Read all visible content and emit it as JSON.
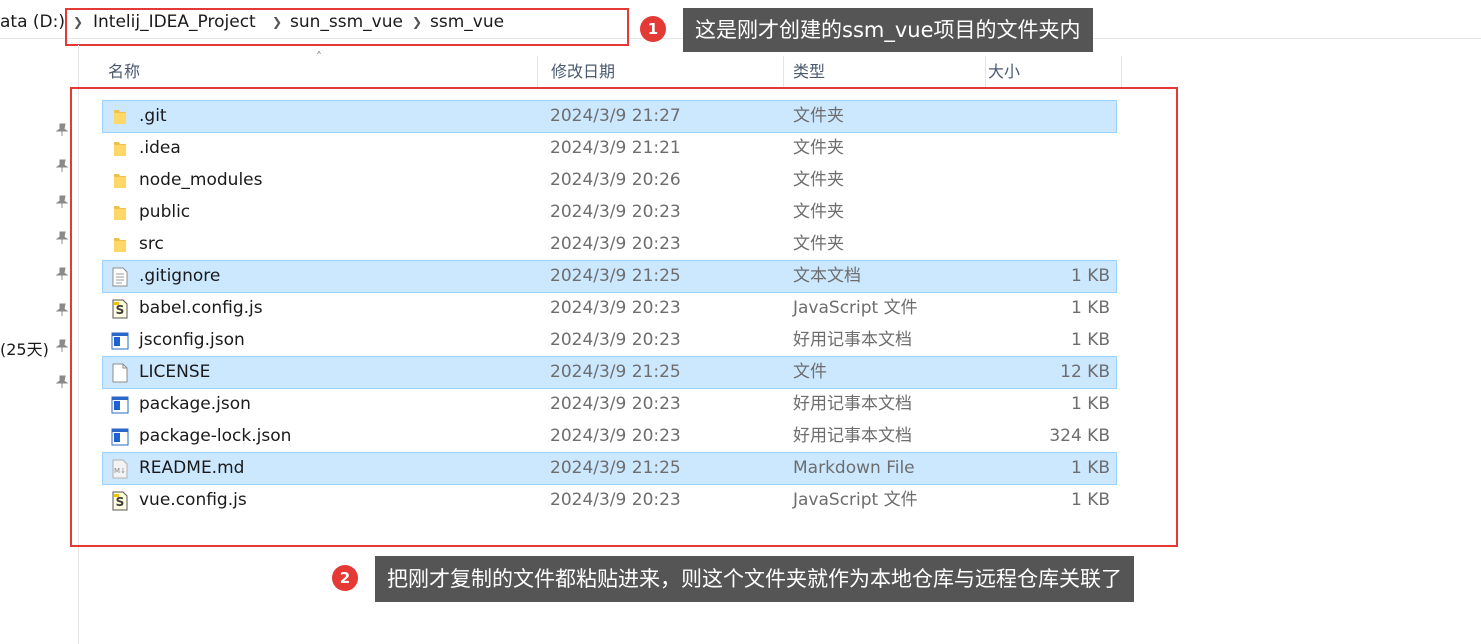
{
  "address": {
    "drive": "ata (D:)",
    "crumbs": [
      "Intelij_IDEA_Project",
      "sun_ssm_vue",
      "ssm_vue"
    ]
  },
  "annotations": {
    "one": {
      "num": "1",
      "text": "这是刚才创建的ssm_vue项目的文件夹内"
    },
    "two": {
      "num": "2",
      "text": "把刚才复制的文件都粘贴进来，则这个文件夹就作为本地仓库与远程仓库关联了"
    }
  },
  "nav": {
    "partial_item": "(25天)"
  },
  "columns": {
    "name": "名称",
    "modified": "修改日期",
    "type": "类型",
    "size": "大小"
  },
  "files": [
    {
      "name": ".git",
      "date": "2024/3/9 21:27",
      "type": "文件夹",
      "size": "",
      "icon": "folder-icon",
      "selected": true
    },
    {
      "name": ".idea",
      "date": "2024/3/9 21:21",
      "type": "文件夹",
      "size": "",
      "icon": "folder-icon",
      "selected": false
    },
    {
      "name": "node_modules",
      "date": "2024/3/9 20:26",
      "type": "文件夹",
      "size": "",
      "icon": "folder-icon",
      "selected": false
    },
    {
      "name": "public",
      "date": "2024/3/9 20:23",
      "type": "文件夹",
      "size": "",
      "icon": "folder-icon",
      "selected": false
    },
    {
      "name": "src",
      "date": "2024/3/9 20:23",
      "type": "文件夹",
      "size": "",
      "icon": "folder-icon",
      "selected": false
    },
    {
      "name": ".gitignore",
      "date": "2024/3/9 21:25",
      "type": "文本文档",
      "size": "1 KB",
      "icon": "text-file-icon",
      "selected": true
    },
    {
      "name": "babel.config.js",
      "date": "2024/3/9 20:23",
      "type": "JavaScript 文件",
      "size": "1 KB",
      "icon": "script-file-icon",
      "selected": false
    },
    {
      "name": "jsconfig.json",
      "date": "2024/3/9 20:23",
      "type": "好用记事本文档",
      "size": "1 KB",
      "icon": "notepad-file-icon",
      "selected": false
    },
    {
      "name": "LICENSE",
      "date": "2024/3/9 21:25",
      "type": "文件",
      "size": "12 KB",
      "icon": "blank-file-icon",
      "selected": true
    },
    {
      "name": "package.json",
      "date": "2024/3/9 20:23",
      "type": "好用记事本文档",
      "size": "1 KB",
      "icon": "notepad-file-icon",
      "selected": false
    },
    {
      "name": "package-lock.json",
      "date": "2024/3/9 20:23",
      "type": "好用记事本文档",
      "size": "324 KB",
      "icon": "notepad-file-icon",
      "selected": false
    },
    {
      "name": "README.md",
      "date": "2024/3/9 21:25",
      "type": "Markdown File",
      "size": "1 KB",
      "icon": "markdown-file-icon",
      "selected": true
    },
    {
      "name": "vue.config.js",
      "date": "2024/3/9 20:23",
      "type": "JavaScript 文件",
      "size": "1 KB",
      "icon": "script-file-icon",
      "selected": false
    }
  ],
  "colors": {
    "selection": "#cce8ff",
    "annotation_red": "#e53935",
    "callout_bg": "#555555",
    "folder": "#f0c24b"
  }
}
